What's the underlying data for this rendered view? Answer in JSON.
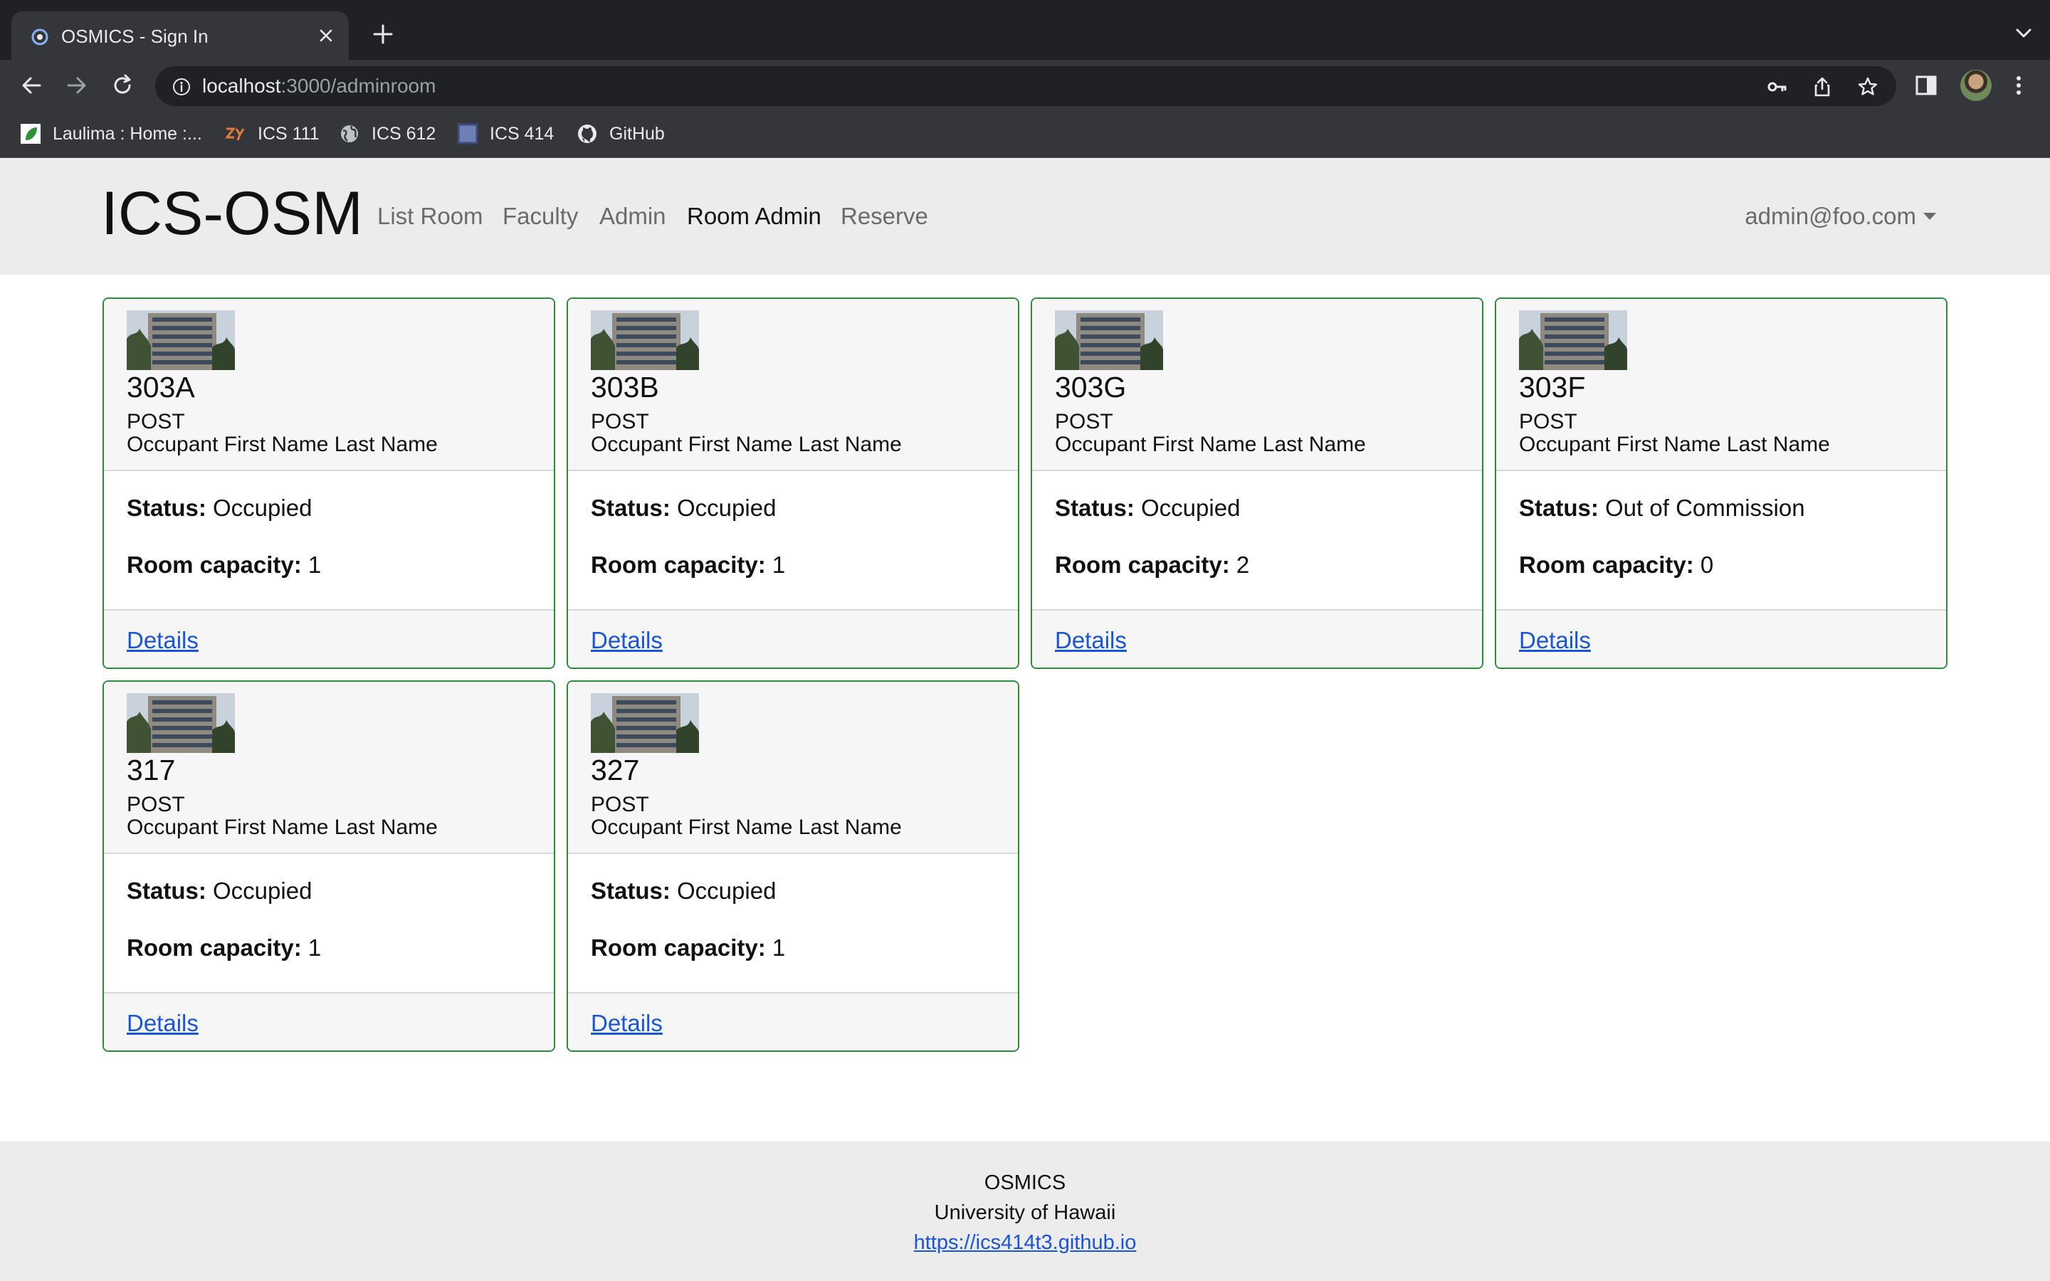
{
  "browser": {
    "tab_title": "OSMICS - Sign In",
    "url_host": "localhost",
    "url_rest": ":3000/adminroom",
    "bookmarks": [
      {
        "label": "Laulima : Home :...",
        "icon": "laulima-icon"
      },
      {
        "label": "ICS 111",
        "icon": "zybooks-icon"
      },
      {
        "label": "ICS 612",
        "icon": "globe-icon"
      },
      {
        "label": "ICS 414",
        "icon": "square-icon"
      },
      {
        "label": "GitHub",
        "icon": "github-icon"
      }
    ]
  },
  "navbar": {
    "brand": "ICS-OSM",
    "links": [
      "List Room",
      "Faculty",
      "Admin",
      "Room Admin",
      "Reserve"
    ],
    "active": "Room Admin",
    "user": "admin@foo.com"
  },
  "labels": {
    "status": "Status:",
    "capacity": "Room capacity:",
    "details": "Details"
  },
  "rooms": [
    {
      "name": "303A",
      "building": "POST",
      "occupant": "Occupant First Name Last Name",
      "status": "Occupied",
      "capacity": "1"
    },
    {
      "name": "303B",
      "building": "POST",
      "occupant": "Occupant First Name Last Name",
      "status": "Occupied",
      "capacity": "1"
    },
    {
      "name": "303G",
      "building": "POST",
      "occupant": "Occupant First Name Last Name",
      "status": "Occupied",
      "capacity": "2"
    },
    {
      "name": "303F",
      "building": "POST",
      "occupant": "Occupant First Name Last Name",
      "status": "Out of Commission",
      "capacity": "0"
    },
    {
      "name": "317",
      "building": "POST",
      "occupant": "Occupant First Name Last Name",
      "status": "Occupied",
      "capacity": "1"
    },
    {
      "name": "327",
      "building": "POST",
      "occupant": "Occupant First Name Last Name",
      "status": "Occupied",
      "capacity": "1"
    }
  ],
  "footer": {
    "line1": "OSMICS",
    "line2": "University of Hawaii",
    "link": "https://ics414t3.github.io"
  },
  "colors": {
    "card_border": "#2e8b3e",
    "link": "#1a55d8",
    "navbar_bg": "#ececec"
  }
}
